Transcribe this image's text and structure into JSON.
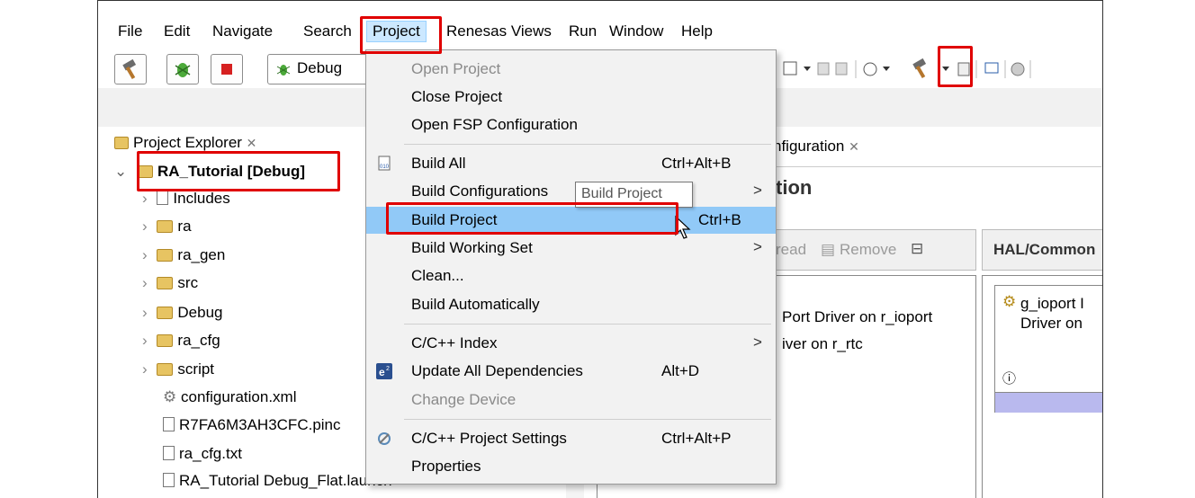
{
  "menubar": {
    "items": [
      "File",
      "Edit",
      "Navigate",
      "Search",
      "Project",
      "Renesas Views",
      "Run",
      "Window",
      "Help"
    ]
  },
  "toolbar": {
    "build_config": "Debug"
  },
  "explorer": {
    "tab_label": "Project Explorer",
    "project": "RA_Tutorial [Debug]",
    "items": [
      {
        "label": "Includes",
        "expandable": true,
        "icon": "includes-icon"
      },
      {
        "label": "ra",
        "expandable": true,
        "icon": "source-folder-icon"
      },
      {
        "label": "ra_gen",
        "expandable": true,
        "icon": "source-folder-icon"
      },
      {
        "label": "src",
        "expandable": true,
        "icon": "source-folder-icon"
      },
      {
        "label": "Debug",
        "expandable": true,
        "icon": "folder-icon"
      },
      {
        "label": "ra_cfg",
        "expandable": true,
        "icon": "folder-icon"
      },
      {
        "label": "script",
        "expandable": true,
        "icon": "folder-icon"
      },
      {
        "label": "configuration.xml",
        "expandable": false,
        "icon": "gear-file-icon"
      },
      {
        "label": "R7FA6M3AH3CFC.pinc",
        "expandable": false,
        "icon": "file-icon"
      },
      {
        "label": "ra_cfg.txt",
        "expandable": false,
        "icon": "file-icon"
      },
      {
        "label": "RA_Tutorial Debug_Flat.launch",
        "expandable": false,
        "icon": "file-icon"
      }
    ]
  },
  "editor": {
    "tab_label": "nfiguration",
    "title": "tion",
    "stack_toolbar": [
      "read",
      "Remove"
    ],
    "hal_title": "HAL/Common",
    "threads": [
      "Port Driver on r_ioport",
      "iver on r_rtc"
    ],
    "hal_block": [
      "g_ioport I",
      "Driver on"
    ]
  },
  "project_menu": {
    "items": [
      {
        "label": "Open Project",
        "shortcut": "",
        "disabled": true,
        "submenu": false
      },
      {
        "label": "Close Project",
        "shortcut": "",
        "disabled": false,
        "submenu": false
      },
      {
        "label": "Open FSP Configuration",
        "shortcut": "",
        "disabled": false,
        "submenu": false
      },
      {
        "label": "Build All",
        "shortcut": "Ctrl+Alt+B",
        "disabled": false,
        "submenu": false
      },
      {
        "label": "Build Configurations",
        "shortcut": "",
        "disabled": false,
        "submenu": true
      },
      {
        "label": "Build Project",
        "shortcut": "Ctrl+B",
        "disabled": false,
        "submenu": false
      },
      {
        "label": "Build Working Set",
        "shortcut": "",
        "disabled": false,
        "submenu": true
      },
      {
        "label": "Clean...",
        "shortcut": "",
        "disabled": false,
        "submenu": false
      },
      {
        "label": "Build Automatically",
        "shortcut": "",
        "disabled": false,
        "submenu": false
      },
      {
        "label": "C/C++ Index",
        "shortcut": "",
        "disabled": false,
        "submenu": true
      },
      {
        "label": "Update All Dependencies",
        "shortcut": "Alt+D",
        "disabled": false,
        "submenu": false
      },
      {
        "label": "Change Device",
        "shortcut": "",
        "disabled": true,
        "submenu": false
      },
      {
        "label": "C/C++ Project Settings",
        "shortcut": "Ctrl+Alt+P",
        "disabled": false,
        "submenu": false
      },
      {
        "label": "Properties",
        "shortcut": "",
        "disabled": false,
        "submenu": false
      }
    ],
    "tooltip": "Build Project"
  },
  "colors": {
    "highlight": "#91c9f7",
    "annotation_red": "#e00000",
    "menu_bg": "#f2f2f2"
  }
}
